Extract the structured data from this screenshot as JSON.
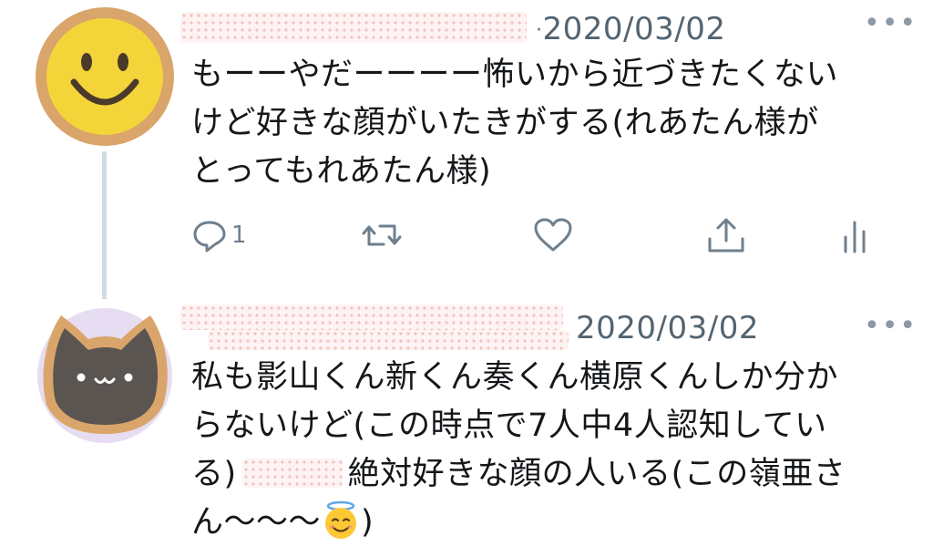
{
  "tweets": [
    {
      "date": "2020/03/02",
      "more_icon": "ellipsis-icon",
      "lines": [
        "もーーやだーーーー怖いから近づきたくない",
        "けど好きな顔がいたきがする(れあたん様が",
        "とってもれあたん様)"
      ],
      "actions": {
        "reply_count": "1",
        "reply_icon": "reply-icon",
        "retweet_icon": "retweet-icon",
        "like_icon": "heart-icon",
        "share_icon": "share-icon",
        "analytics_icon": "analytics-icon"
      },
      "avatar": {
        "kind": "smiley",
        "color": "#f3d53a",
        "border": "#d9a56a"
      }
    },
    {
      "date": "2020/03/02",
      "more_icon": "ellipsis-icon",
      "lines": [
        "私も影山くん新くん奏くん横原くんしか分か",
        "らないけど(この時点で7人中4人認知してい"
      ],
      "line3_a": "る)",
      "line3_b": "絶対好きな顔の人いる(この嶺亜さ",
      "line4": "ん〜〜〜",
      "line4_end": ")",
      "avatar": {
        "kind": "cat",
        "color": "#5b5552",
        "border": "#d9a56a",
        "face": "• ω •"
      }
    }
  ],
  "colors": {
    "meta": "#536471",
    "icon": "#6e7f8d",
    "thread_line": "#cfd9de"
  }
}
